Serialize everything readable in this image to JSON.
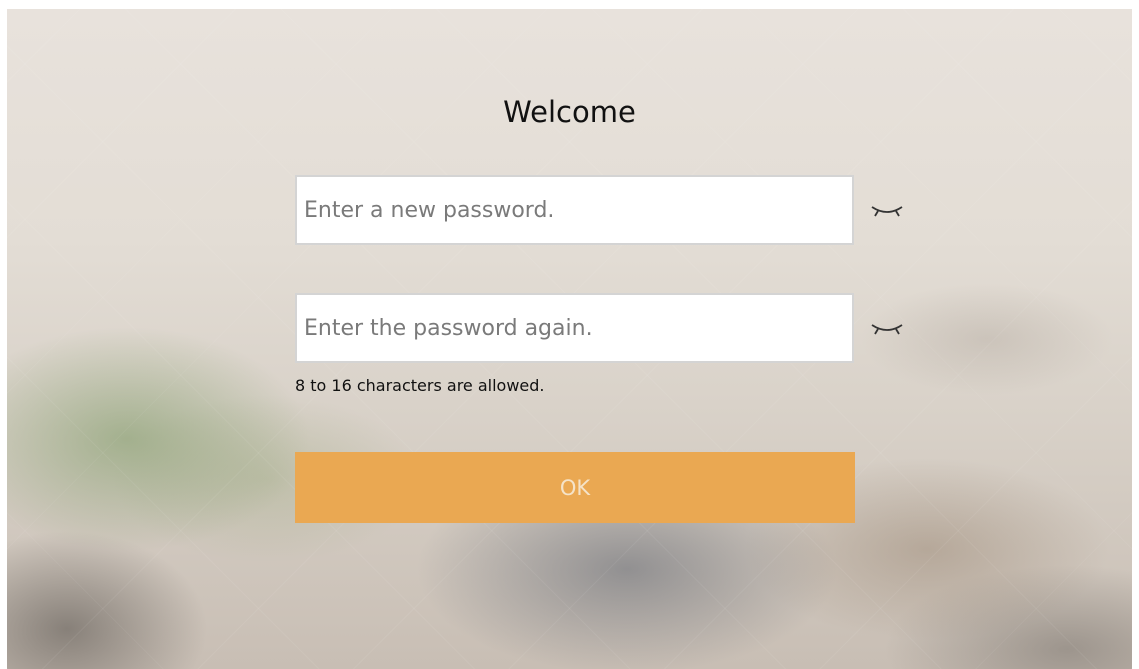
{
  "welcome": {
    "title": "Welcome"
  },
  "form": {
    "new_password": {
      "placeholder": "Enter a new password.",
      "value": "",
      "toggle_icon": "eye-closed-icon"
    },
    "confirm_password": {
      "placeholder": "Enter the password again.",
      "value": "",
      "toggle_icon": "eye-closed-icon"
    },
    "hint": "8 to 16 characters are allowed.",
    "ok_label": "OK"
  },
  "colors": {
    "ok_button": "#eaa852",
    "ok_text_disabled": "#f5e3c8"
  }
}
